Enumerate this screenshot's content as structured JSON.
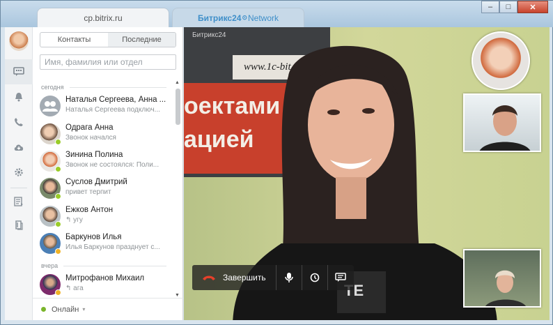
{
  "window": {
    "tab_active": "cp.bitrix.ru",
    "tab2_brand": "Битрикс24",
    "tab2_suffix": "Network",
    "btn_min": "–",
    "btn_max": "□",
    "btn_close": "✕"
  },
  "rail": {
    "icons": [
      "chat-icon",
      "bell-icon",
      "phone-icon",
      "cloud-icon",
      "gear-icon",
      "list-icon",
      "book-icon"
    ]
  },
  "contacts": {
    "tab_contacts": "Контакты",
    "tab_recent": "Последние",
    "search_placeholder": "Имя, фамилия или отдел",
    "group_today": "сегодня",
    "group_yesterday": "вчера",
    "items": [
      {
        "name": "Наталья Сергеева, Анна ...",
        "msg": "Наталья Сергеева подключ..."
      },
      {
        "name": "Одрага Анна",
        "msg": "Звонок начался"
      },
      {
        "name": "Зинина Полина",
        "msg": "Звонок не состоялся: Поли..."
      },
      {
        "name": "Суслов Дмитрий",
        "msg": "привет терпит"
      },
      {
        "name": "Ежков Антон",
        "msg": "угу"
      },
      {
        "name": "Баркунов Илья",
        "msg": "Илья Баркунов празднует с..."
      },
      {
        "name": "Митрофанов Михаил",
        "msg": "ага"
      }
    ],
    "status": "Онлайн"
  },
  "video": {
    "brand_label": "Битрикс24",
    "banner_url": "www.1c-bit",
    "banner_line1": "оектами",
    "banner_line2": "ацией",
    "end_call_label": "Завершить"
  },
  "colors": {
    "accent": "#3f8fc9",
    "online": "#9acc29",
    "end_call": "#e5402a"
  }
}
